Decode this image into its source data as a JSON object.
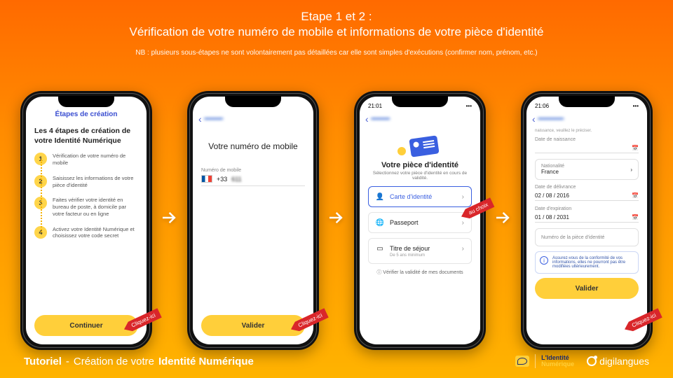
{
  "header": {
    "title_line1": "Etape 1 et 2 :",
    "title_line2": "Vérification de votre numéro de mobile et informations de votre pièce d'identité",
    "note": "NB : plusieurs sous-étapes ne sont volontairement pas détaillées car elle sont simples d'exécutions (confirmer nom, prénom, etc.)"
  },
  "callouts": {
    "click_here": "Cliquez-ici",
    "au_choix": "au choix"
  },
  "phone1": {
    "nav_title": "Étapes de création",
    "heading": "Les 4 étapes de création de votre Identité Numérique",
    "steps": [
      "Vérification de votre numéro de mobile",
      "Saisissez les informations de votre pièce d'identité",
      "Faites vérifier votre identité en bureau de poste, à domicile par votre facteur ou en ligne",
      "Activez votre Identité Numérique et choisissez votre code secret"
    ],
    "cta": "Continuer"
  },
  "phone2": {
    "heading": "Votre numéro de mobile",
    "field_label": "Numéro de mobile",
    "country_code": "+33",
    "number_prefix": "611",
    "cta": "Valider"
  },
  "phone3": {
    "time": "21:01",
    "heading": "Votre pièce d'identité",
    "sub": "Sélectionnez votre pièce d'identité en cours de validité.",
    "options": {
      "cni": "Carte d'identité",
      "passport": "Passeport",
      "sejour": "Titre de séjour",
      "sejour_sub": "De 5 ans minimum"
    },
    "link": "Vérifier la validité de mes documents"
  },
  "phone4": {
    "time": "21:06",
    "top_hint": "naissance, veuillez le préciser.",
    "labels": {
      "dob": "Date de naissance",
      "nat": "Nationalité",
      "nat_val": "France",
      "deliv": "Date de délivrance",
      "deliv_val": "02 / 08 / 2016",
      "exp": "Date d'expiration",
      "exp_val": "01 / 08 / 2031",
      "docnum": "Numéro de la pièce d'identité"
    },
    "info": "Assurez-vous de la conformité de vos informations, elles ne pourront pas être modifiées ultérieurement.",
    "cta": "Valider"
  },
  "footer": {
    "left1": "Tutoriel",
    "dash": " - ",
    "left2": "Création de votre ",
    "left3": "Identité Numérique",
    "id_logo_l1": "L'Identité",
    "id_logo_l2": "Numérique",
    "brand": "digilangues"
  }
}
